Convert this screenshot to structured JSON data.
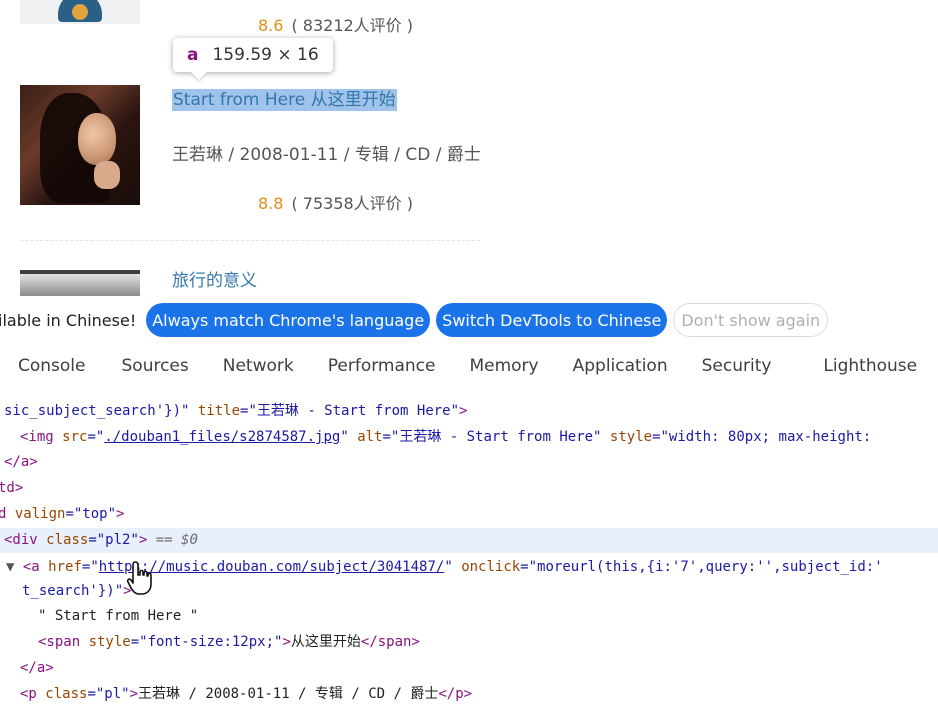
{
  "page": {
    "rating1": {
      "score": "8.6",
      "count": "( 83212人评价 )"
    },
    "tooltip": {
      "tag": "a",
      "size": "159.59 × 16"
    },
    "album": {
      "title": "Start from Here 从这里开始",
      "meta": "王若琳 / 2008-01-11 / 专辑 / CD / 爵士",
      "score": "8.8",
      "count": "( 75358人评价 )"
    },
    "next_title": "旅行的意义"
  },
  "lang_bar": {
    "message": "ilable in Chinese!",
    "always_match": "Always match Chrome's language",
    "switch": "Switch DevTools to Chinese",
    "dont_show": "Don't show again"
  },
  "tabs": [
    "Console",
    "Sources",
    "Network",
    "Performance",
    "Memory",
    "Application",
    "Security",
    "Lighthouse"
  ],
  "code": {
    "l1": {
      "a": "sic_subject_search'})\" ",
      "attr": "title",
      "eq": "=",
      "val": "\"王若琳 - Start from Here\"",
      "end": ">"
    },
    "l2": {
      "open": "<img ",
      "src_attr": "src",
      "src_q1": "=\"",
      "src_link": "./douban1_files/s2874587.jpg",
      "src_q2": "\" ",
      "alt_attr": "alt",
      "alt_val": "=\"王若琳 - Start from Here\" ",
      "style_attr": "style",
      "style_val": "=\"width: 80px; max-height:"
    },
    "l3": "</a>",
    "l4": "td>",
    "l5": {
      "open": "d ",
      "attr": "valign",
      "val": "=\"top\"",
      "close": ">"
    },
    "l6": {
      "open": "<div ",
      "attr": "class",
      "val": "=\"pl2\"",
      "close": ">",
      "eq": " == ",
      "dollar": "$0"
    },
    "l7": {
      "tri": "▼",
      "open": "<a ",
      "attr": "href",
      "q1": "=\"",
      "link": "https://music.douban.com/subject/3041487/",
      "q2": "\" ",
      "attr2": "onclick",
      "val2": "=\"moreurl(this,{i:'7',query:'',subject_id:'"
    },
    "l8": {
      "val": "t_search'})\"",
      "close": ">"
    },
    "l9": "\" Start from Here \"",
    "l10": {
      "open": "<span ",
      "attr": "style",
      "val": "=\"font-size:12px;\"",
      "close": ">",
      "text": "从这里开始",
      "end": "</span>"
    },
    "l11": "</a>",
    "l12": {
      "open": "<p ",
      "attr": "class",
      "val": "=\"pl\"",
      "close": ">",
      "text": "王若琳 / 2008-01-11 / 专辑 / CD / 爵士",
      "end": "</p>"
    }
  },
  "colors": {
    "link": "#3377aa",
    "rating": "#e09015",
    "chrome_blue": "#1a73e8",
    "tag": "#881280",
    "attr": "#994500",
    "value": "#1a1aa6"
  },
  "icons": [
    "pointer-hand-icon",
    "expand-triangle-icon"
  ]
}
